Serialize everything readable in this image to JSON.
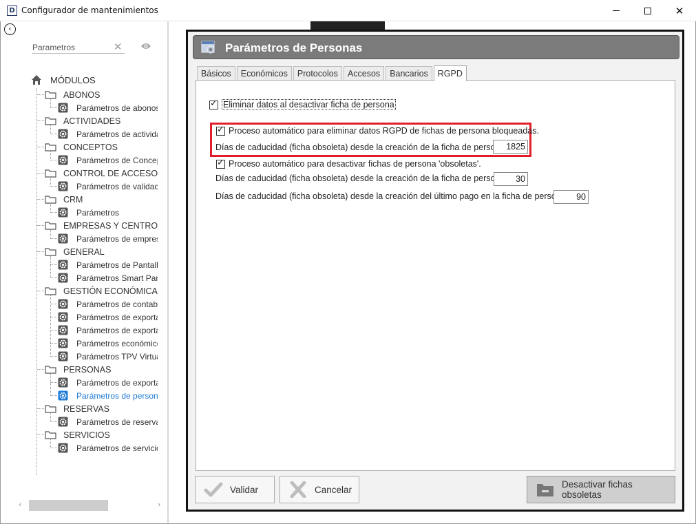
{
  "window": {
    "title": "Configurador de mantenimientos",
    "app_icon_letter": "D",
    "controls": {
      "minimize": "minimize",
      "maximize": "maximize",
      "close": "✕"
    }
  },
  "sidebar": {
    "back_icon": "‹",
    "search": {
      "value": "Parametros",
      "placeholder": "Parametros",
      "clear_icon": "✕"
    },
    "root_label": "MÓDULOS",
    "groups": [
      {
        "label": "ABONOS",
        "items": [
          "Parámetros de abonos"
        ]
      },
      {
        "label": "ACTIVIDADES",
        "items": [
          "Parámetros de actividades"
        ]
      },
      {
        "label": "CONCEPTOS",
        "items": [
          "Parámetros de Conceptos"
        ]
      },
      {
        "label": "CONTROL DE ACCESO",
        "items": [
          "Parámetros de validación"
        ]
      },
      {
        "label": "CRM",
        "items": [
          "Parámetros"
        ]
      },
      {
        "label": "EMPRESAS Y CENTROS",
        "items": [
          "Parámetros de empresas"
        ]
      },
      {
        "label": "GENERAL",
        "items": [
          "Parámetros de Pantalla",
          "Parámetros Smart Panel"
        ]
      },
      {
        "label": "GESTIÓN ECONÓMICA",
        "items": [
          "Parámetros de contabilidad",
          "Parámetros de exportación",
          "Parámetros de exportación",
          "Parámetros económicos",
          "Parámetros TPV Virtual"
        ]
      },
      {
        "label": "PERSONAS",
        "items": [
          "Parámetros de exportación",
          "Parámetros de personas"
        ]
      },
      {
        "label": "RESERVAS",
        "items": [
          "Parámetros de reservas"
        ]
      },
      {
        "label": "SERVICIOS",
        "items": [
          "Parámetros de servicios"
        ]
      }
    ],
    "selected_item": "Parámetros de personas",
    "scroll": {
      "left": "‹",
      "right": "›"
    }
  },
  "panel": {
    "title": "Parámetros de Personas",
    "tabs": [
      "Básicos",
      "Económicos",
      "Protocolos",
      "Accesos",
      "Bancarios",
      "RGPD"
    ],
    "active_tab": "RGPD",
    "rgpd": {
      "delete_on_deactivate": {
        "label": "Eliminar datos al desactivar ficha de persona",
        "checked": true
      },
      "auto_delete_blocked": {
        "label": "Proceso automático para eliminar datos RGPD de fichas de persona bloqueadas.",
        "checked": true
      },
      "expiry_days_creation_1": {
        "label": "Días de caducidad (ficha obsoleta) desde la creación de la ficha de persona",
        "value": "1825"
      },
      "auto_deactivate_obsolete": {
        "label": "Proceso automático para desactivar fichas de persona 'obsoletas'.",
        "checked": true
      },
      "expiry_days_creation_2": {
        "label": "Días de caducidad (ficha obsoleta) desde la creación de la ficha de persona",
        "value": "30"
      },
      "expiry_days_last_payment": {
        "label": "Días de caducidad (ficha obsoleta) desde la creación del último pago en la ficha de persona",
        "value": "90"
      }
    },
    "buttons": {
      "validate": "Validar",
      "cancel": "Cancelar",
      "deactivate_obsolete": "Desactivar fichas obsoletas"
    }
  },
  "colors": {
    "highlight": "#e21d2a",
    "header_bar": "#7b7b7b",
    "selected_text": "#1e7bd8"
  }
}
